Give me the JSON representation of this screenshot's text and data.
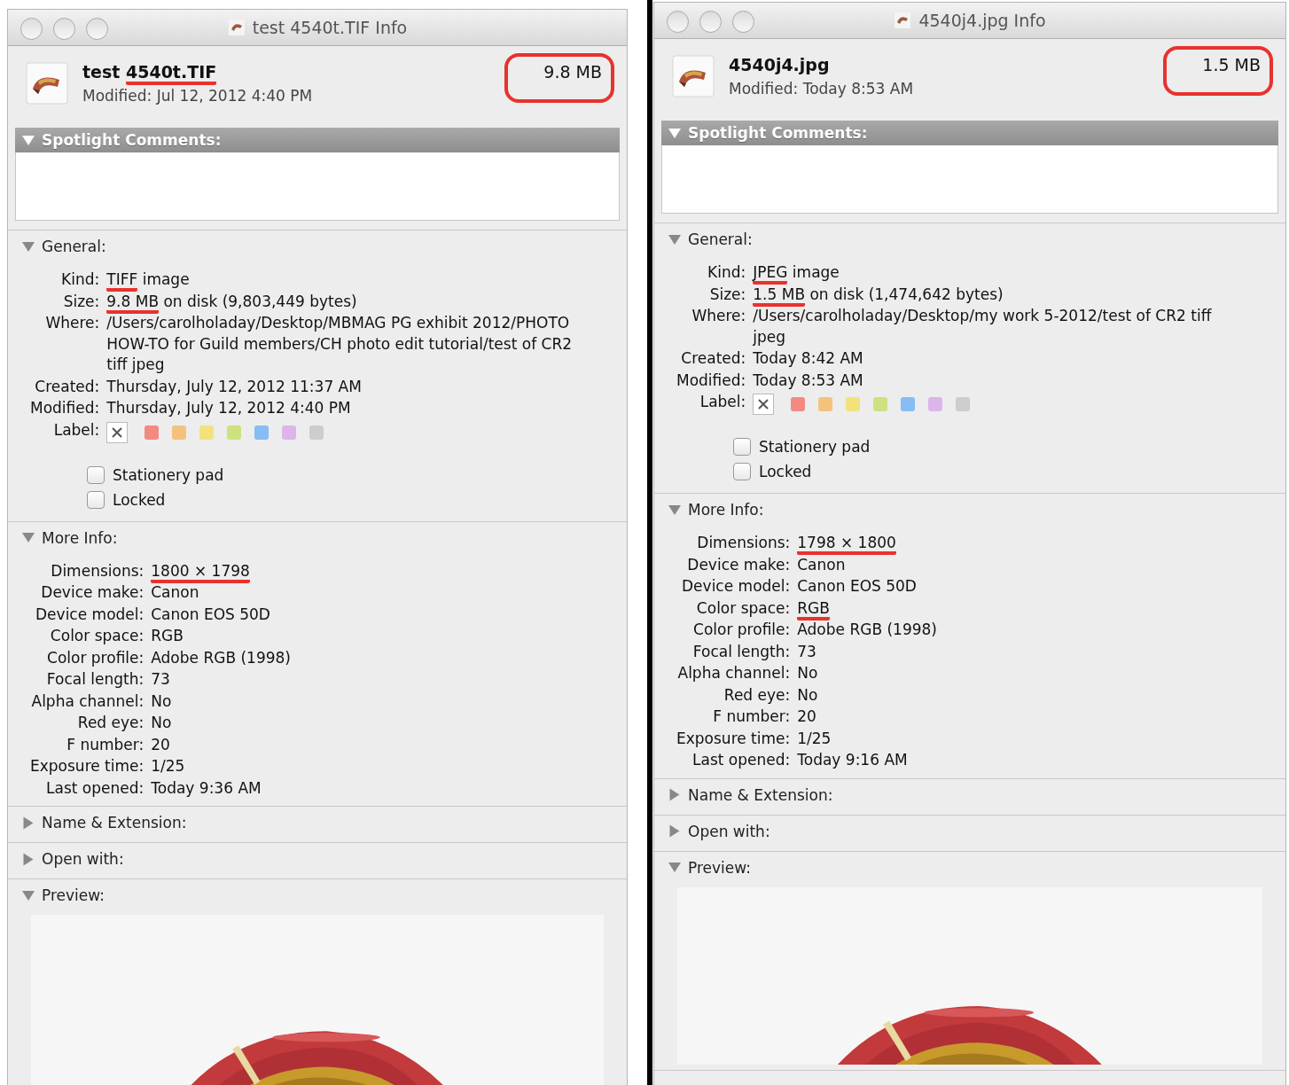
{
  "windows": [
    {
      "title": "test 4540t.TIF Info",
      "name_parts": [
        {
          "text": "test ",
          "underlined": false
        },
        {
          "text": "4540t.TIF",
          "underlined": true
        }
      ],
      "modified": "Modified: Jul 12, 2012 4:40 PM",
      "size": "9.8 MB",
      "size_circled": true,
      "sections": [
        {
          "kind": "comments",
          "title": "Spotlight Comments:",
          "expanded": true
        },
        {
          "kind": "general",
          "title": "General:",
          "expanded": true,
          "fields": [
            {
              "label": "Kind:",
              "parts": [
                {
                  "text": "TIFF",
                  "underlined": true
                },
                {
                  "text": " image",
                  "underlined": false
                }
              ]
            },
            {
              "label": "Size:",
              "parts": [
                {
                  "text": "9.8 MB",
                  "underlined": true
                },
                {
                  "text": " on disk (9,803,449 bytes)",
                  "underlined": false
                }
              ]
            },
            {
              "label": "Where:",
              "parts": [
                {
                  "text": "/Users/carolholaday/Desktop/MBMAG PG exhibit 2012/PHOTO HOW-TO for Guild members/CH photo edit tutorial/test of CR2 tiff jpeg",
                  "underlined": false
                }
              ]
            },
            {
              "label": "Created:",
              "parts": [
                {
                  "text": "Thursday, July 12, 2012 11:37 AM",
                  "underlined": false
                }
              ]
            },
            {
              "label": "Modified:",
              "parts": [
                {
                  "text": "Thursday, July 12, 2012 4:40 PM",
                  "underlined": false
                }
              ]
            }
          ],
          "label_caption": "Label:",
          "label_colors": [
            {
              "color": "#f28a82"
            },
            {
              "color": "#f5c27e"
            },
            {
              "color": "#f2e27c"
            },
            {
              "color": "#cde27e"
            },
            {
              "color": "#86bdf5"
            },
            {
              "color": "#dcb6ea"
            },
            {
              "color": "#cdcdcd"
            }
          ],
          "checkboxes": [
            {
              "label": "Stationery pad",
              "checked": false
            },
            {
              "label": "Locked",
              "checked": false
            }
          ]
        },
        {
          "kind": "fields",
          "title": "More Info:",
          "expanded": true,
          "fields": [
            {
              "label": "Dimensions:",
              "parts": [
                {
                  "text": "1800 × 1798",
                  "underlined": true
                }
              ]
            },
            {
              "label": "Device make:",
              "parts": [
                {
                  "text": "Canon",
                  "underlined": false
                }
              ]
            },
            {
              "label": "Device model:",
              "parts": [
                {
                  "text": "Canon EOS 50D",
                  "underlined": false
                }
              ]
            },
            {
              "label": "Color space:",
              "parts": [
                {
                  "text": "RGB",
                  "underlined": false
                }
              ]
            },
            {
              "label": "Color profile:",
              "parts": [
                {
                  "text": "Adobe RGB (1998)",
                  "underlined": false
                }
              ]
            },
            {
              "label": "Focal length:",
              "parts": [
                {
                  "text": "73",
                  "underlined": false
                }
              ]
            },
            {
              "label": "Alpha channel:",
              "parts": [
                {
                  "text": "No",
                  "underlined": false
                }
              ]
            },
            {
              "label": "Red eye:",
              "parts": [
                {
                  "text": "No",
                  "underlined": false
                }
              ]
            },
            {
              "label": "F number:",
              "parts": [
                {
                  "text": "20",
                  "underlined": false
                }
              ]
            },
            {
              "label": "Exposure time:",
              "parts": [
                {
                  "text": "1/25",
                  "underlined": false
                }
              ]
            },
            {
              "label": "Last opened:",
              "parts": [
                {
                  "text": "Today 9:36 AM",
                  "underlined": false
                }
              ]
            }
          ]
        },
        {
          "kind": "collapsed",
          "title": "Name & Extension:",
          "expanded": false
        },
        {
          "kind": "collapsed",
          "title": "Open with:",
          "expanded": false
        },
        {
          "kind": "preview",
          "title": "Preview:",
          "expanded": true
        }
      ]
    },
    {
      "title": "4540j4.jpg Info",
      "name_parts": [
        {
          "text": "4540j4.jpg",
          "underlined": false
        }
      ],
      "modified": "Modified: Today 8:53 AM",
      "size": "1.5 MB",
      "size_circled": true,
      "sections": [
        {
          "kind": "comments",
          "title": "Spotlight Comments:",
          "expanded": true
        },
        {
          "kind": "general",
          "title": "General:",
          "expanded": true,
          "fields": [
            {
              "label": "Kind:",
              "parts": [
                {
                  "text": "JPEG",
                  "underlined": true
                },
                {
                  "text": " image",
                  "underlined": false
                }
              ]
            },
            {
              "label": "Size:",
              "parts": [
                {
                  "text": "1.5 MB",
                  "underlined": true
                },
                {
                  "text": " on disk (1,474,642 bytes)",
                  "underlined": false
                }
              ]
            },
            {
              "label": "Where:",
              "parts": [
                {
                  "text": "/Users/carolholaday/Desktop/my work 5-2012/test of CR2 tiff jpeg",
                  "underlined": false
                }
              ]
            },
            {
              "label": "Created:",
              "parts": [
                {
                  "text": "Today 8:42 AM",
                  "underlined": false
                }
              ]
            },
            {
              "label": "Modified:",
              "parts": [
                {
                  "text": "Today 8:53 AM",
                  "underlined": false
                }
              ]
            }
          ],
          "label_caption": "Label:",
          "label_colors": [
            {
              "color": "#f28a82"
            },
            {
              "color": "#f5c27e"
            },
            {
              "color": "#f2e27c"
            },
            {
              "color": "#cde27e"
            },
            {
              "color": "#86bdf5"
            },
            {
              "color": "#dcb6ea"
            },
            {
              "color": "#cdcdcd"
            }
          ],
          "checkboxes": [
            {
              "label": "Stationery pad",
              "checked": false
            },
            {
              "label": "Locked",
              "checked": false
            }
          ]
        },
        {
          "kind": "fields",
          "title": "More Info:",
          "expanded": true,
          "fields": [
            {
              "label": "Dimensions:",
              "parts": [
                {
                  "text": "1798 × 1800",
                  "underlined": true
                }
              ]
            },
            {
              "label": "Device make:",
              "parts": [
                {
                  "text": "Canon",
                  "underlined": false
                }
              ]
            },
            {
              "label": "Device model:",
              "parts": [
                {
                  "text": "Canon EOS 50D",
                  "underlined": false
                }
              ]
            },
            {
              "label": "Color space:",
              "parts": [
                {
                  "text": "RGB",
                  "underlined": true
                }
              ]
            },
            {
              "label": "Color profile:",
              "parts": [
                {
                  "text": "Adobe RGB (1998)",
                  "underlined": false
                }
              ]
            },
            {
              "label": "Focal length:",
              "parts": [
                {
                  "text": "73",
                  "underlined": false
                }
              ]
            },
            {
              "label": "Alpha channel:",
              "parts": [
                {
                  "text": "No",
                  "underlined": false
                }
              ]
            },
            {
              "label": "Red eye:",
              "parts": [
                {
                  "text": "No",
                  "underlined": false
                }
              ]
            },
            {
              "label": "F number:",
              "parts": [
                {
                  "text": "20",
                  "underlined": false
                }
              ]
            },
            {
              "label": "Exposure time:",
              "parts": [
                {
                  "text": "1/25",
                  "underlined": false
                }
              ]
            },
            {
              "label": "Last opened:",
              "parts": [
                {
                  "text": "Today 9:16 AM",
                  "underlined": false
                }
              ]
            }
          ]
        },
        {
          "kind": "collapsed",
          "title": "Name & Extension:",
          "expanded": false
        },
        {
          "kind": "collapsed",
          "title": "Open with:",
          "expanded": false
        },
        {
          "kind": "preview",
          "title": "Preview:",
          "expanded": true
        }
      ]
    }
  ]
}
